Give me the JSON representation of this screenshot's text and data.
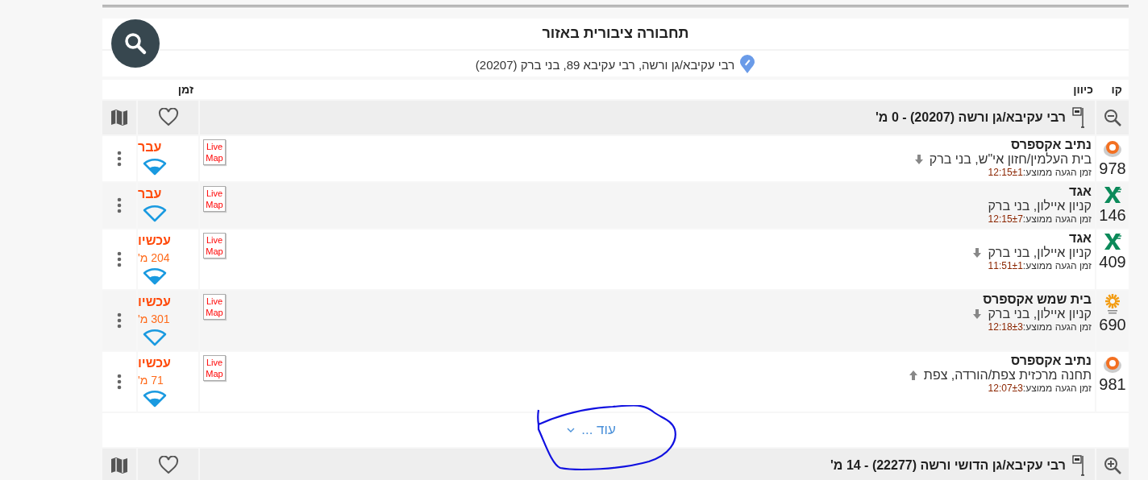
{
  "header": {
    "title": "תחבורה ציבורית באזור",
    "address": "רבי עקיבא/גן ורשה, רבי עקיבא 89, בני ברק (20207)"
  },
  "columns": {
    "line": "קו",
    "direction": "כיוון",
    "time": "זמן"
  },
  "stations": [
    {
      "name": "רבי עקיבא/גן ורשה (20207) - 0 מ'",
      "expanded": true,
      "arrivals": [
        {
          "line": "978",
          "kind": "ring",
          "operator": "נתיב אקספרס",
          "destination": "בית העלמין/חזון אי\"ש, בני ברק",
          "arrow": {
            "kind": "down"
          },
          "eta_label": "זמן הגעה ממוצע:",
          "eta": "12:15±1",
          "status": "עבר",
          "live": true,
          "badge": "Live Map"
        },
        {
          "line": "146",
          "kind": "cross",
          "operator": "אגד",
          "destination": "קניון איילון, בני ברק",
          "eta_label": "זמן הגעה ממוצע:",
          "eta": "12:15±7",
          "status": "עבר",
          "live": false,
          "badge": "Live Map"
        },
        {
          "line": "409",
          "kind": "cross",
          "operator": "אגד",
          "destination": "קניון איילון, בני ברק",
          "arrow": {
            "kind": "down"
          },
          "eta_label": "זמן הגעה ממוצע:",
          "eta": "11:51±1",
          "status": "עכשיו",
          "distance": "204 מ'",
          "live": true,
          "badge": "Live Map"
        },
        {
          "line": "690",
          "kind": "sunburst",
          "operator": "בית שמש אקספרס",
          "destination": "קניון איילון, בני ברק",
          "arrow": {
            "kind": "down"
          },
          "eta_label": "זמן הגעה ממוצע:",
          "eta": "12:18±3",
          "status": "עכשיו",
          "distance": "301 מ'",
          "live": false,
          "badge": "Live Map"
        },
        {
          "line": "981",
          "kind": "ring",
          "operator": "נתיב אקספרס",
          "destination": "תחנה מרכזית צפת/הורדה, צפת",
          "arrow": {
            "kind": "up"
          },
          "eta_label": "זמן הגעה ממוצע:",
          "eta": "12:07±3",
          "status": "עכשיו",
          "distance": "71 מ'",
          "live": true,
          "badge": "Live Map"
        }
      ],
      "more": "עוד ..."
    },
    {
      "name": "רבי עקיבא/גן הדושי ורשה (22277) - 14 מ'",
      "expanded": false
    }
  ]
}
